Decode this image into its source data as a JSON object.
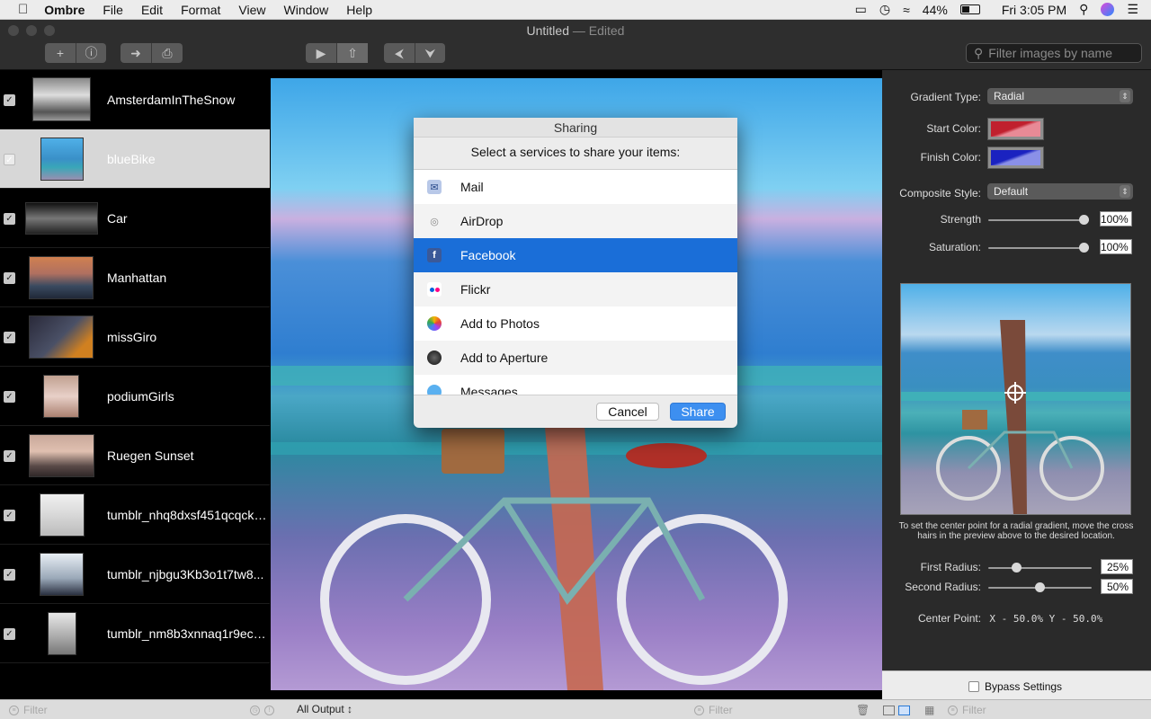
{
  "menubar": {
    "app": "Ombre",
    "menus": [
      "File",
      "Edit",
      "Format",
      "View",
      "Window",
      "Help"
    ],
    "battery": "44%",
    "clock": "Fri 3:05 PM"
  },
  "window": {
    "title": "Untitled",
    "title_suffix": "— Edited",
    "filter_placeholder": "Filter images by name"
  },
  "images": [
    {
      "name": "AmsterdamInTheSnow",
      "checked": true,
      "selected": false
    },
    {
      "name": "blueBike",
      "checked": true,
      "selected": true
    },
    {
      "name": "Car",
      "checked": true,
      "selected": false
    },
    {
      "name": "Manhattan",
      "checked": true,
      "selected": false
    },
    {
      "name": "missGiro",
      "checked": true,
      "selected": false
    },
    {
      "name": "podiumGirls",
      "checked": true,
      "selected": false
    },
    {
      "name": "Ruegen Sunset",
      "checked": true,
      "selected": false
    },
    {
      "name": "tumblr_nhq8dxsf451qcqckt...",
      "checked": true,
      "selected": false
    },
    {
      "name": "tumblr_njbgu3Kb3o1t7tw8...",
      "checked": true,
      "selected": false
    },
    {
      "name": "tumblr_nm8b3xnnaq1r9ecc...",
      "checked": true,
      "selected": false
    }
  ],
  "sheet": {
    "title": "Sharing",
    "prompt": "Select a services to share your items:",
    "services": [
      {
        "label": "Mail",
        "icon": "mail-icon",
        "selected": false
      },
      {
        "label": "AirDrop",
        "icon": "airdrop-icon",
        "selected": false
      },
      {
        "label": "Facebook",
        "icon": "facebook-icon",
        "selected": true
      },
      {
        "label": "Flickr",
        "icon": "flickr-icon",
        "selected": false
      },
      {
        "label": "Add to Photos",
        "icon": "photos-icon",
        "selected": false
      },
      {
        "label": "Add to Aperture",
        "icon": "aperture-icon",
        "selected": false
      },
      {
        "label": "Messages",
        "icon": "messages-icon",
        "selected": false
      }
    ],
    "cancel_label": "Cancel",
    "share_label": "Share"
  },
  "panel": {
    "gradient_type_label": "Gradient Type:",
    "gradient_type": "Radial",
    "start_color_label": "Start Color:",
    "start_color": "#c0202e",
    "finish_color_label": "Finish Color:",
    "finish_color": "#1a22c0",
    "composite_style_label": "Composite Style:",
    "composite_style": "Default",
    "strength_label": "Strength",
    "strength": "100%",
    "strength_value": 1.0,
    "saturation_label": "Saturation:",
    "saturation": "100%",
    "saturation_value": 1.0,
    "hint": "To set the center point  for a radial gradient, move the cross hairs in the preview above to the desired location.",
    "first_radius_label": "First Radius:",
    "first_radius": "25%",
    "first_radius_value": 0.25,
    "second_radius_label": "Second Radius:",
    "second_radius": "50%",
    "second_radius_value": 0.5,
    "center_point_label": "Center Point:",
    "center_point_value": "X - 50.0%  Y - 50.0%",
    "bypass_label": "Bypass Settings"
  },
  "bottombar": {
    "filter_placeholder": "Filter",
    "output_selector": "All Output ↕",
    "filter2_placeholder": "Filter",
    "filter3_placeholder": "Filter"
  }
}
